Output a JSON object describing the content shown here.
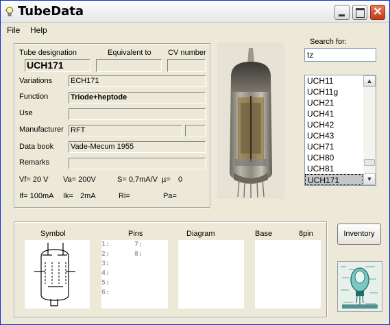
{
  "window": {
    "title": "TubeData"
  },
  "menu": {
    "file": "File",
    "help": "Help"
  },
  "details": {
    "tube_designation_label": "Tube designation",
    "equivalent_label": "Equivalent to",
    "cv_number_label": "CV number",
    "tube_designation": "UCH171",
    "equivalent": "",
    "cv_number": "",
    "variations_label": "Variations",
    "variations": "ECH171",
    "function_label": "Function",
    "function": "Triode+heptode",
    "use_label": "Use",
    "use": "",
    "manufacturer_label": "Manufacturer",
    "manufacturer": "RFT",
    "manufacturer_code": "",
    "databook_label": "Data book",
    "databook": "Vade-Mecum 1955",
    "remarks_label": "Remarks",
    "remarks": "",
    "params_row1": [
      "Vf= 20 V",
      "Va= 200V",
      "S= 0,7mA/V",
      "µ=",
      "0"
    ],
    "params_row2": [
      "If= 100mA",
      "Ik=",
      "2mA",
      "Ri=",
      "Pa="
    ]
  },
  "search": {
    "label": "Search for:",
    "value": "tz",
    "results": [
      "UCH11",
      "UCH11g",
      "UCH21",
      "UCH41",
      "UCH42",
      "UCH43",
      "UCH71",
      "UCH80",
      "UCH81",
      "UCH171"
    ],
    "selected": "UCH171"
  },
  "bottom": {
    "symbol_label": "Symbol",
    "pins_label": "Pins",
    "diagram_label": "Diagram",
    "base_label": "Base",
    "base_value": "8pin",
    "pins_left": [
      "1:",
      "2:",
      "3:",
      "4:",
      "5:",
      "6:"
    ],
    "pins_right": [
      "7:",
      "8:"
    ]
  },
  "inventory_button": "Inventory",
  "colors": {
    "window_bg": "#ece9d8",
    "selection": "#c6c6c6",
    "title_close": "#c53a17"
  }
}
